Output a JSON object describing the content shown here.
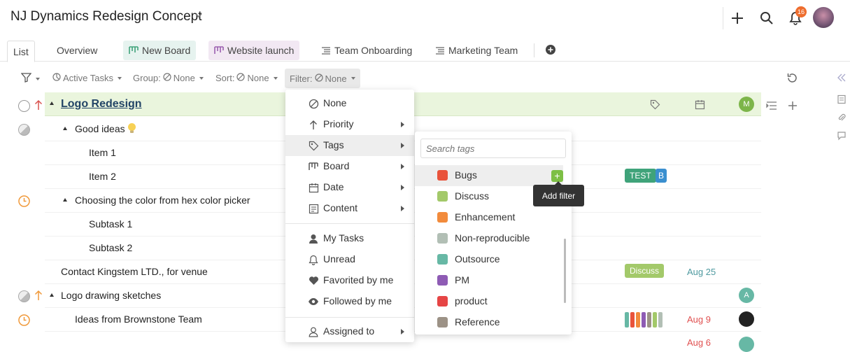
{
  "header": {
    "title": "NJ Dynamics Redesign Concept",
    "notification_count": "16"
  },
  "tabs": [
    {
      "label": "List",
      "active": true
    },
    {
      "label": "Overview"
    },
    {
      "label": "New Board",
      "icon": "board-icon"
    },
    {
      "label": "Website launch",
      "icon": "board-icon"
    },
    {
      "label": "Team Onboarding",
      "icon": "list-icon"
    },
    {
      "label": "Marketing Team",
      "icon": "list-icon"
    }
  ],
  "toolbar": {
    "active_tasks": "Active Tasks",
    "group_label": "Group:",
    "group_value": "None",
    "sort_label": "Sort:",
    "sort_value": "None",
    "filter_label": "Filter:",
    "filter_value": "None"
  },
  "tasks": {
    "header": {
      "title": "Logo Redesign",
      "avatar": "M"
    },
    "rows": [
      {
        "title": "Good ideas"
      },
      {
        "title": "Item 1"
      },
      {
        "title": "Item 2",
        "tags": [
          "TEST",
          "B"
        ]
      },
      {
        "title": "Choosing the color from hex color picker"
      },
      {
        "title": "Subtask 1"
      },
      {
        "title": "Subtask 2"
      },
      {
        "title": "Contact Kingstem LTD., for venue",
        "tag": "Discuss",
        "date": "Aug 25"
      },
      {
        "title": "Logo drawing sketches",
        "avatar": "A"
      },
      {
        "title": "Ideas from Brownstone Team",
        "date": "Aug 9"
      }
    ],
    "partial_date": "Aug 6"
  },
  "filter_menu": {
    "items": [
      "None",
      "Priority",
      "Tags",
      "Board",
      "Date",
      "Content"
    ],
    "items2": [
      "My Tasks",
      "Unread",
      "Favorited by me",
      "Followed by me"
    ],
    "assigned": "Assigned to"
  },
  "tags_submenu": {
    "placeholder": "Search tags",
    "tags": [
      {
        "name": "Bugs",
        "color": "#e9533b"
      },
      {
        "name": "Discuss",
        "color": "#a3c96a"
      },
      {
        "name": "Enhancement",
        "color": "#f28b3c"
      },
      {
        "name": "Non-reproducible",
        "color": "#b2bfb5"
      },
      {
        "name": "Outsource",
        "color": "#67b8a5"
      },
      {
        "name": "PM",
        "color": "#8e5bb4"
      },
      {
        "name": "product",
        "color": "#e64545"
      },
      {
        "name": "Reference",
        "color": "#9c9286"
      }
    ],
    "tooltip": "Add filter"
  },
  "colors": {
    "accent": "#1b5f9c",
    "header_bg": "#eaf5dd",
    "tag_test": "#3fa37a",
    "tag_b": "#3a8fcf",
    "tag_discuss": "#a3c96a",
    "date_red": "#e05050",
    "date_teal": "#4f9aa0"
  }
}
